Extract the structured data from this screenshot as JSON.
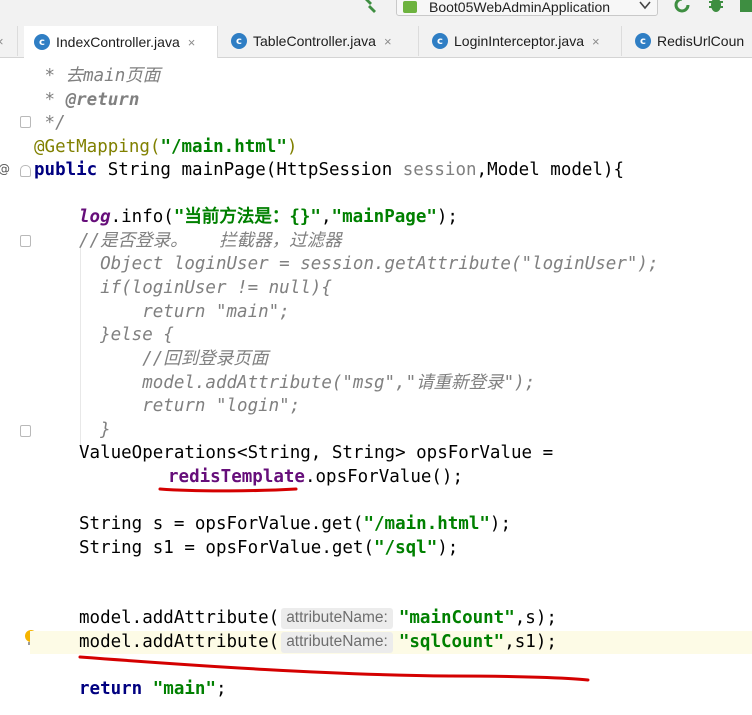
{
  "toolbar": {
    "run_config_label": "Boot05WebAdminApplication",
    "hammer_icon": "hammer-icon",
    "run_icon": "rerun-icon",
    "debug_icon": "debug-bug-icon"
  },
  "tabs": [
    {
      "label": "IndexController.java",
      "active": true,
      "close": "×"
    },
    {
      "label": "TableController.java",
      "active": false,
      "close": "×"
    },
    {
      "label": "LoginInterceptor.java",
      "active": false,
      "close": "×"
    },
    {
      "label": "RedisUrlCoun",
      "active": false,
      "close": ""
    }
  ],
  "code": {
    "l1_star": " * ",
    "l1_comment": "去main页面",
    "l2_star": " * ",
    "l2_tag": "@return",
    "l3": " */",
    "l4_anno": "@GetMapping(",
    "l4_str": "\"/main.html\"",
    "l4_close": ")",
    "l5_kw": "public",
    "l5_rest1": " String mainPage(HttpSession ",
    "l5_param": "session",
    "l5_rest2": ",Model model){",
    "l7_field": "log",
    "l7_rest1": ".info(",
    "l7_str1": "\"当前方法是：{}\"",
    "l7_comma": ",",
    "l7_str2": "\"mainPage\"",
    "l7_end": ");",
    "l8_comment": "//是否登录。   拦截器，过滤器",
    "l9": "  Object loginUser = session.getAttribute(\"loginUser\");",
    "l10": "  if(loginUser != null){",
    "l11": "      return \"main\";",
    "l12": "  }else {",
    "l13": "      //回到登录页面",
    "l14": "      model.addAttribute(\"msg\",\"请重新登录\");",
    "l15": "      return \"login\";",
    "l16": "  }",
    "l17": "ValueOperations<String, String> opsForValue =",
    "l18_field": "redisTemplate",
    "l18_rest": ".opsForValue();",
    "l20_a": "String s = opsForValue.get(",
    "l20_str": "\"/main.html\"",
    "l20_b": ");",
    "l21_a": "String s1 = opsForValue.get(",
    "l21_str": "\"/sql\"",
    "l21_b": ");",
    "l24_a": "model.addAttribute(",
    "l24_hint": "attributeName:",
    "l24_str": "\"mainCount\"",
    "l24_b": ",s);",
    "l25_a": "model.addAttribute(",
    "l25_hint": "attributeName:",
    "l25_str": "\"sqlCount\"",
    "l25_b": ",s1);",
    "l27_kw": "return",
    "l27_str": "\"main\"",
    "l27_b": ";"
  },
  "gutter": {
    "bean_marker": "@",
    "bulb_icon": "lightbulb-icon"
  },
  "colors": {
    "keyword": "#000080",
    "string": "#008000",
    "annotation": "#808000",
    "comment": "#808080",
    "field": "#660e7a",
    "annotation_ink": "#d40000"
  }
}
